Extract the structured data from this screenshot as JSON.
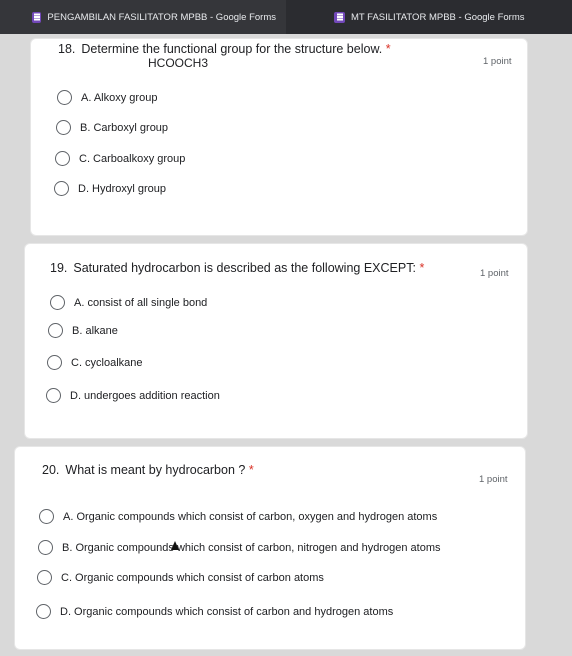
{
  "tabs": [
    {
      "label": "PENGAMBILAN FASILITATOR MPBB - Google Forms",
      "icon": "google-forms-icon"
    },
    {
      "label": "MT FASILITATOR MPBB - Google Forms",
      "icon": "google-forms-icon"
    }
  ],
  "questions": [
    {
      "number": "18.",
      "text": "Determine the functional group for the structure below.",
      "required_mark": "*",
      "subtext": "HCOOCH3",
      "points": "1 point",
      "options": [
        "A.  Alkoxy group",
        "B.  Carboxyl group",
        "C.  Carboalkoxy group",
        "D.  Hydroxyl group"
      ]
    },
    {
      "number": "19.",
      "text": "Saturated hydrocarbon is described as the following EXCEPT:",
      "required_mark": "*",
      "points": "1 point",
      "options": [
        "A.  consist of all single bond",
        "B.  alkane",
        "C.  cycloalkane",
        "D.  undergoes addition reaction"
      ]
    },
    {
      "number": "20.",
      "text": "What is meant by  hydrocarbon ?",
      "required_mark": "*",
      "points": "1 point",
      "options": [
        "A.  Organic compounds which consist of carbon, oxygen and hydrogen atoms",
        "B.  Organic compounds which consist of carbon, nitrogen and hydrogen atoms",
        "C.  Organic compounds which consist of carbon atoms",
        "D.  Organic compounds which consist of carbon and hydrogen atoms"
      ]
    }
  ],
  "colors": {
    "required": "#d93025",
    "tab_bar": "#202124",
    "forms_brand": "#7248b9"
  }
}
